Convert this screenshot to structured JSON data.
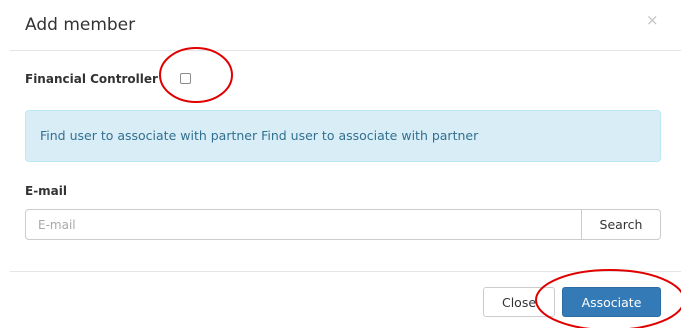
{
  "modal": {
    "title": "Add member",
    "close_glyph": "×"
  },
  "financial_controller": {
    "label": "Financial Controller",
    "checked": false
  },
  "alert": {
    "text": "Find user to associate with partner Find user to associate with partner"
  },
  "email": {
    "label": "E-mail",
    "value": "",
    "placeholder": "E-mail",
    "search_label": "Search"
  },
  "footer": {
    "close_label": "Close",
    "associate_label": "Associate"
  },
  "colors": {
    "primary": "#337ab7",
    "info_bg": "#d9edf7",
    "info_text": "#31708f",
    "annotation": "#e00000"
  },
  "icons": {
    "close": "close-icon",
    "checkbox": "checkbox-icon"
  }
}
